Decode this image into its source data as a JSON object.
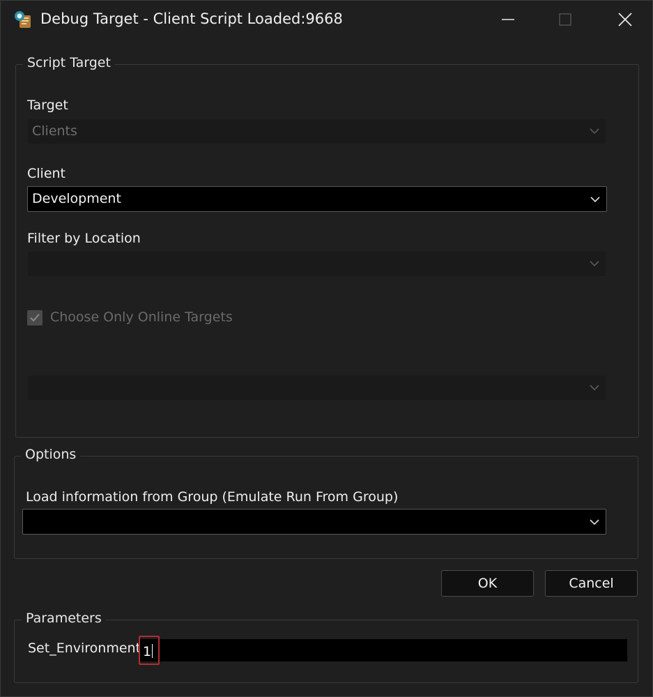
{
  "window": {
    "title": "Debug Target - Client Script Loaded:9668",
    "icon": "script-debug-icon"
  },
  "script_target": {
    "legend": "Script Target",
    "target_label": "Target",
    "target_value": "Clients",
    "client_label": "Client",
    "client_value": "Development",
    "filter_label": "Filter by Location",
    "filter_value": "",
    "online_checkbox_label": "Choose Only Online Targets",
    "online_checked": true,
    "extra_combo_value": ""
  },
  "options": {
    "legend": "Options",
    "group_label": "Load information from Group (Emulate Run From Group)",
    "group_value": ""
  },
  "buttons": {
    "ok": "OK",
    "cancel": "Cancel"
  },
  "parameters": {
    "legend": "Parameters",
    "name": "Set_Environment",
    "value": "1"
  },
  "colors": {
    "background": "#1f1f1f",
    "focus_border": "#b32d2d"
  }
}
